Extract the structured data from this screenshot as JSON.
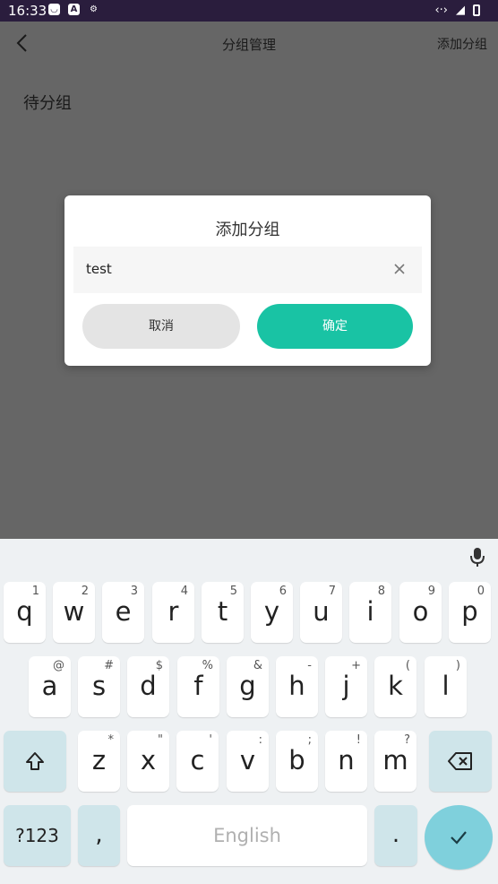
{
  "status_bar": {
    "time": "16:33",
    "left_icons": [
      "notification-app-icon",
      "a-app-icon",
      "settings-icon"
    ],
    "right_icons": [
      "data-arrows-icon",
      "signal-icon",
      "battery-icon"
    ]
  },
  "app_bar": {
    "title": "分组管理",
    "action": "添加分组",
    "back_icon": "chevron-left-icon"
  },
  "content": {
    "section_label": "待分组"
  },
  "dialog": {
    "title": "添加分组",
    "input_value": "test",
    "cancel_label": "取消",
    "confirm_label": "确定",
    "confirm_color": "#19c3a4"
  },
  "keyboard": {
    "row1": [
      {
        "key": "q",
        "sub": "1"
      },
      {
        "key": "w",
        "sub": "2"
      },
      {
        "key": "e",
        "sub": "3"
      },
      {
        "key": "r",
        "sub": "4"
      },
      {
        "key": "t",
        "sub": "5"
      },
      {
        "key": "y",
        "sub": "6"
      },
      {
        "key": "u",
        "sub": "7"
      },
      {
        "key": "i",
        "sub": "8"
      },
      {
        "key": "o",
        "sub": "9"
      },
      {
        "key": "p",
        "sub": "0"
      }
    ],
    "row2": [
      {
        "key": "a",
        "sub": "@"
      },
      {
        "key": "s",
        "sub": "#"
      },
      {
        "key": "d",
        "sub": "$"
      },
      {
        "key": "f",
        "sub": "%"
      },
      {
        "key": "g",
        "sub": "&"
      },
      {
        "key": "h",
        "sub": "-"
      },
      {
        "key": "j",
        "sub": "+"
      },
      {
        "key": "k",
        "sub": "("
      },
      {
        "key": "l",
        "sub": ")"
      }
    ],
    "row3": [
      {
        "key": "z",
        "sub": "*"
      },
      {
        "key": "x",
        "sub": "\""
      },
      {
        "key": "c",
        "sub": "'"
      },
      {
        "key": "v",
        "sub": ":"
      },
      {
        "key": "b",
        "sub": ";"
      },
      {
        "key": "n",
        "sub": "!"
      },
      {
        "key": "m",
        "sub": "?"
      }
    ],
    "symbols_label": "?123",
    "comma_label": ",",
    "space_label": "English",
    "period_label": ".",
    "accent_color": "#7fd0dc"
  }
}
